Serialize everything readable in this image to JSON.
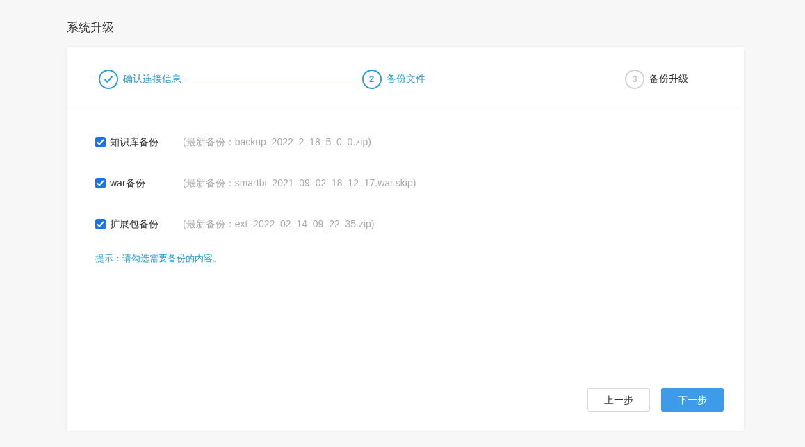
{
  "page_title": "系统升级",
  "steps": [
    {
      "label": "确认连接信息",
      "kind": "done"
    },
    {
      "number": "2",
      "label": "备份文件",
      "kind": "active"
    },
    {
      "number": "3",
      "label": "备份升级",
      "kind": "waiting"
    }
  ],
  "options": [
    {
      "label": "知识库备份",
      "detail": "(最新备份：backup_2022_2_18_5_0_0.zip)",
      "checked": true
    },
    {
      "label": "war备份",
      "detail": "(最新备份：smartbi_2021_09_02_18_12_17.war.skip)",
      "checked": true
    },
    {
      "label": "扩展包备份",
      "detail": "(最新备份：ext_2022_02_14_09_22_35.zip)",
      "checked": true
    }
  ],
  "hint": "提示：请勾选需要备份的内容。",
  "buttons": [
    {
      "label": "上一步",
      "kind": "secondary"
    },
    {
      "label": "下一步",
      "kind": "primary"
    }
  ]
}
